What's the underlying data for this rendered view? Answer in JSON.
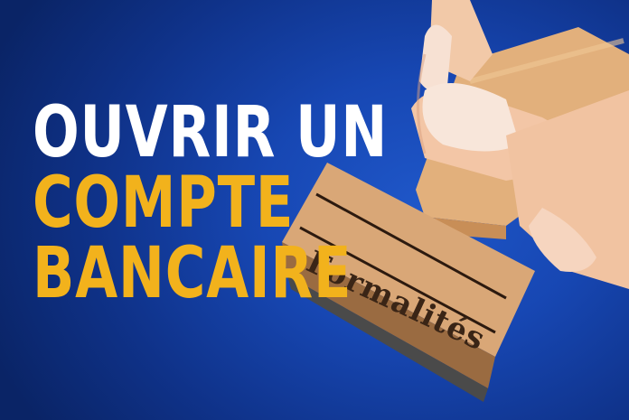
{
  "headline": {
    "line1": "OUVRIR UN",
    "line2": "COMPTE",
    "line3": "BANCAIRE"
  },
  "stamp": {
    "label": "Formalités"
  },
  "colors": {
    "background": "#1747b3",
    "headline_white": "#ffffff",
    "headline_gold": "#f2b21c",
    "wood": "#d9a777"
  }
}
